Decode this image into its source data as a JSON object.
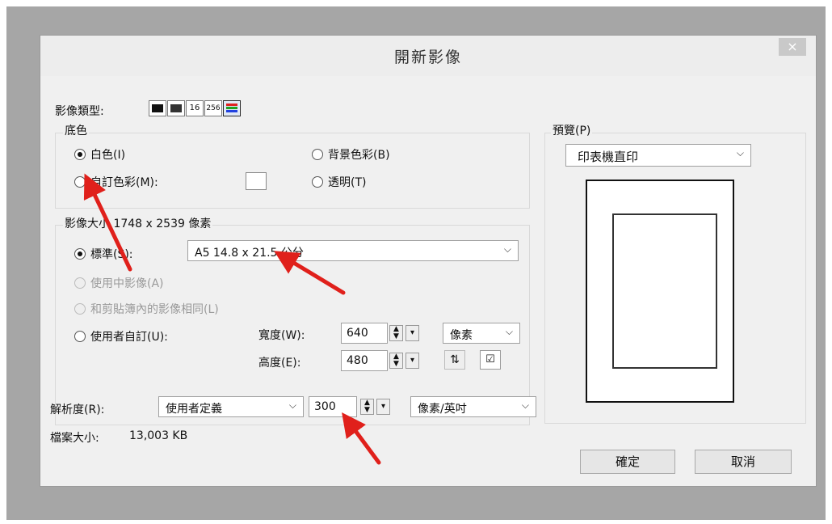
{
  "dialog": {
    "title": "開新影像",
    "close": "×"
  },
  "image_type": {
    "label": "影像類型:",
    "options": [
      "16",
      "256"
    ]
  },
  "background": {
    "group_title": "底色",
    "white": "白色(I)",
    "custom_color": "自訂色彩(M):",
    "bg_color": "背景色彩(B)",
    "transparent": "透明(T)"
  },
  "image_size": {
    "group_title": "影像大小 1748 x 2539 像素",
    "standard": "標準(S):",
    "standard_value": "A5 14.8 x 21.5  公分",
    "use_medium": "使用中影像(A)",
    "same_clipboard": "和剪貼簿內的影像相同(L)",
    "user_defined": "使用者自訂(U):",
    "width_label": "寬度(W):",
    "width_value": "640",
    "height_label": "高度(E):",
    "height_value": "480",
    "unit": "像素"
  },
  "resolution": {
    "label": "解析度(R):",
    "mode": "使用者定義",
    "value": "300",
    "unit": "像素/英吋"
  },
  "file_size": {
    "label": "檔案大小:",
    "value": "13,003 KB"
  },
  "preview": {
    "label": "預覽(P)",
    "mode": "印表機直印"
  },
  "buttons": {
    "ok": "確定",
    "cancel": "取消"
  },
  "annotation_color": "#e0201b"
}
